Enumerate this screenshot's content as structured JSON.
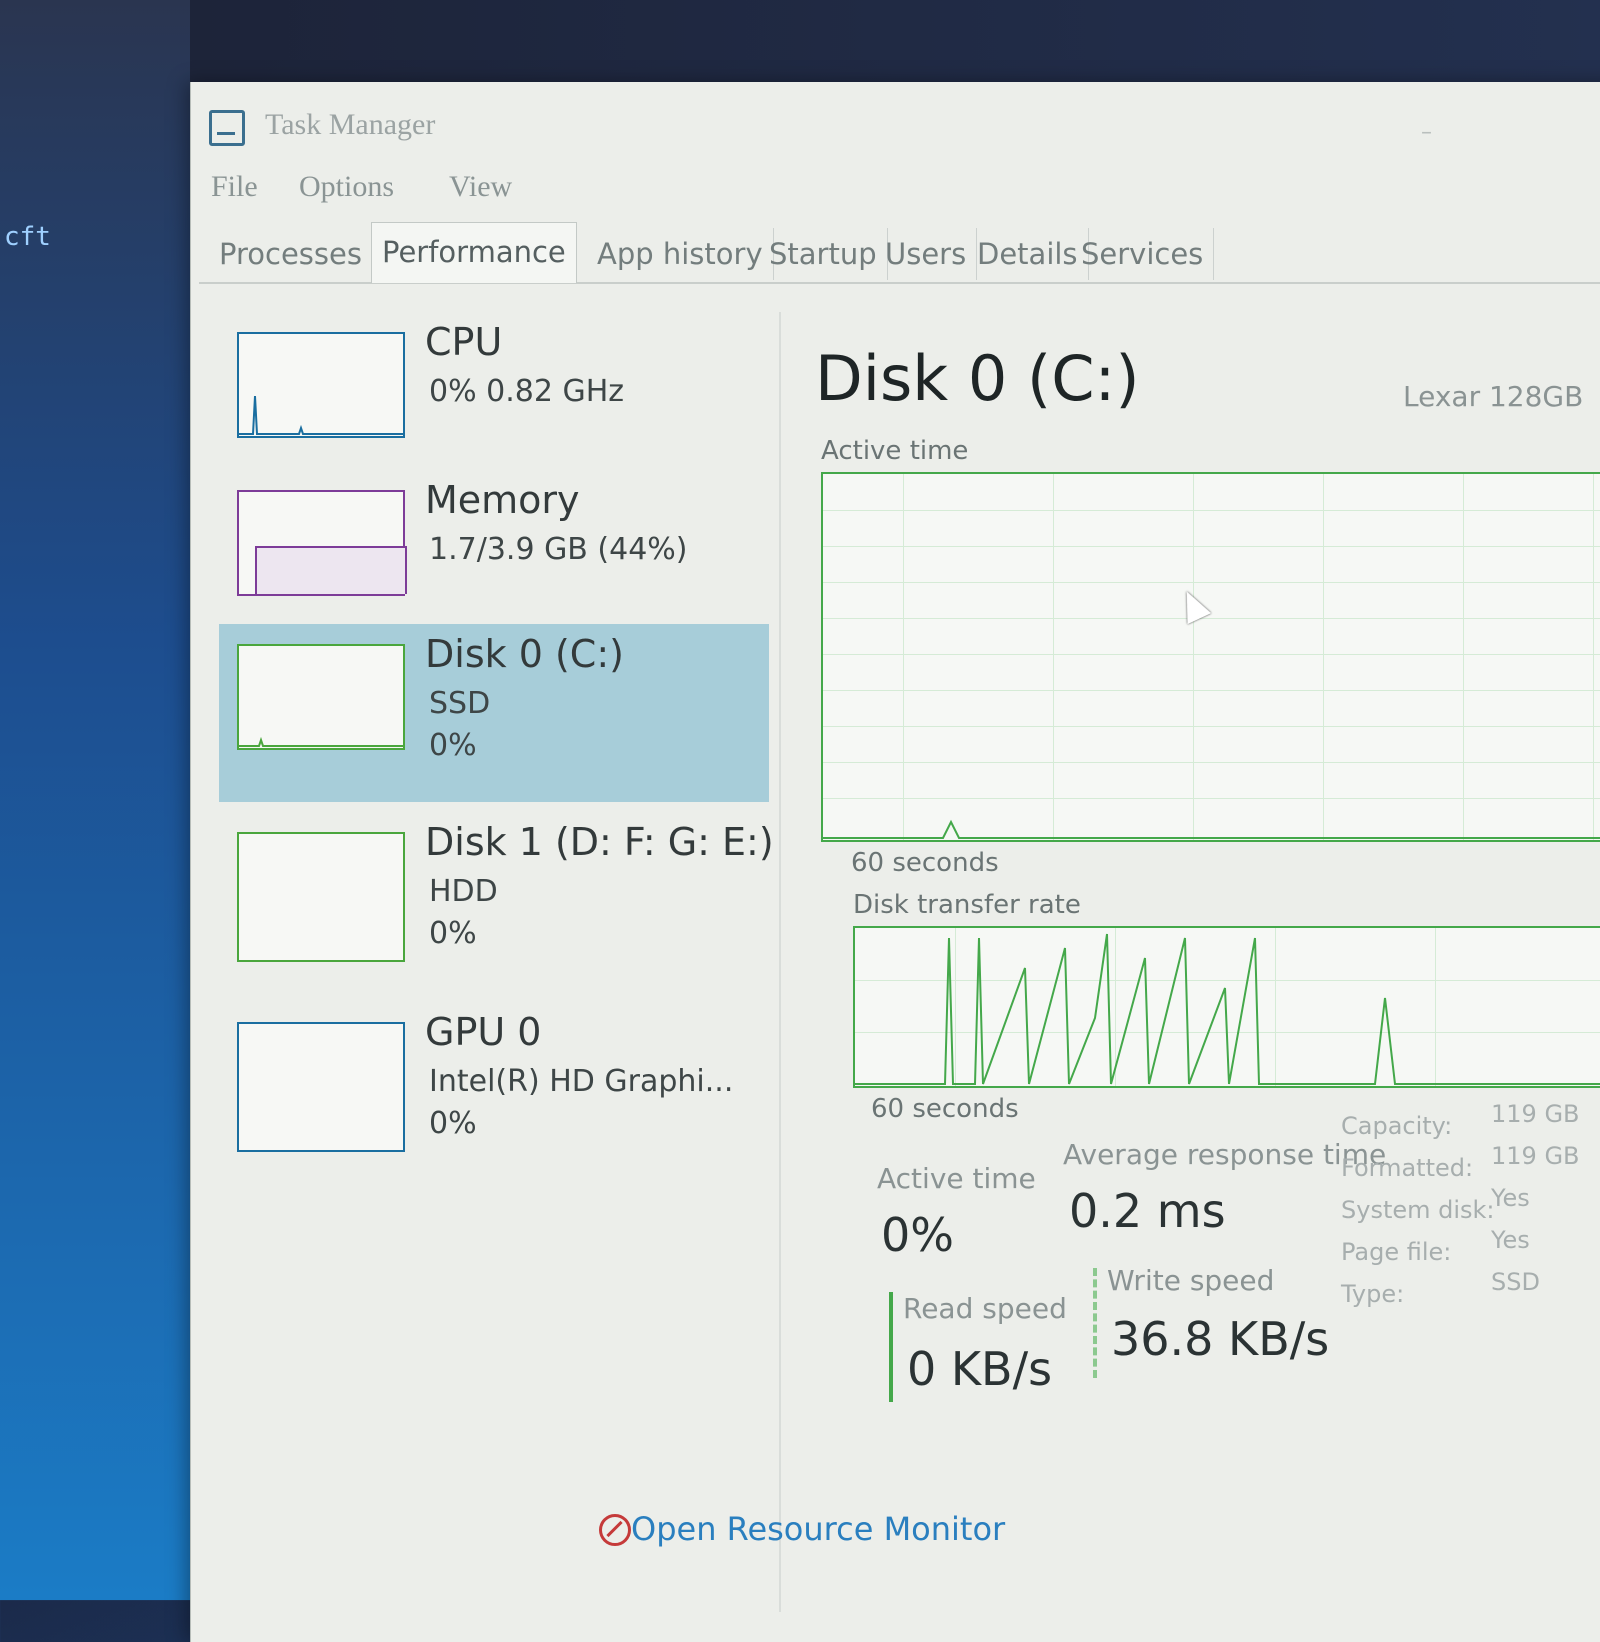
{
  "window": {
    "title": "Task Manager"
  },
  "menu": [
    "File",
    "Options",
    "View"
  ],
  "tabs": [
    {
      "label": "Processes"
    },
    {
      "label": "Performance"
    },
    {
      "label": "App history"
    },
    {
      "label": "Startup"
    },
    {
      "label": "Users"
    },
    {
      "label": "Details"
    },
    {
      "label": "Services"
    }
  ],
  "active_tab": "Performance",
  "sidebar": {
    "items": [
      {
        "title": "CPU",
        "line1": "0% 0.82 GHz",
        "line2": "",
        "color": "#1a6ea0"
      },
      {
        "title": "Memory",
        "line1": "1.7/3.9 GB (44%)",
        "line2": "",
        "color": "#7d3c98"
      },
      {
        "title": "Disk 0 (C:)",
        "line1": "SSD",
        "line2": "0%",
        "color": "#4aa63d"
      },
      {
        "title": "Disk 1 (D: F: G: E:)",
        "line1": "HDD",
        "line2": "0%",
        "color": "#4aa63d"
      },
      {
        "title": "GPU 0",
        "line1": "Intel(R) HD Graphi...",
        "line2": "0%",
        "color": "#1a6ea0"
      }
    ],
    "selected": "Disk 0 (C:)"
  },
  "detail": {
    "title": "Disk 0 (C:)",
    "model": "Lexar 128GB",
    "active_time_chart_label": "Active time",
    "active_time_axis": "60 seconds",
    "transfer_chart_label": "Disk transfer rate",
    "transfer_axis": "60 seconds",
    "stats": {
      "active_time_label": "Active time",
      "active_time_value": "0%",
      "avg_response_label": "Average response time",
      "avg_response_value": "0.2 ms",
      "read_speed_label": "Read speed",
      "read_speed_value": "0 KB/s",
      "write_speed_label": "Write speed",
      "write_speed_value": "36.8 KB/s"
    },
    "properties": [
      {
        "label": "Capacity:",
        "value": "119 GB"
      },
      {
        "label": "Formatted:",
        "value": "119 GB"
      },
      {
        "label": "System disk:",
        "value": "Yes"
      },
      {
        "label": "Page file:",
        "value": "Yes"
      },
      {
        "label": "Type:",
        "value": "SSD"
      }
    ]
  },
  "footer": {
    "link": "Open Resource Monitor"
  },
  "desktop": {
    "text": "cft"
  }
}
